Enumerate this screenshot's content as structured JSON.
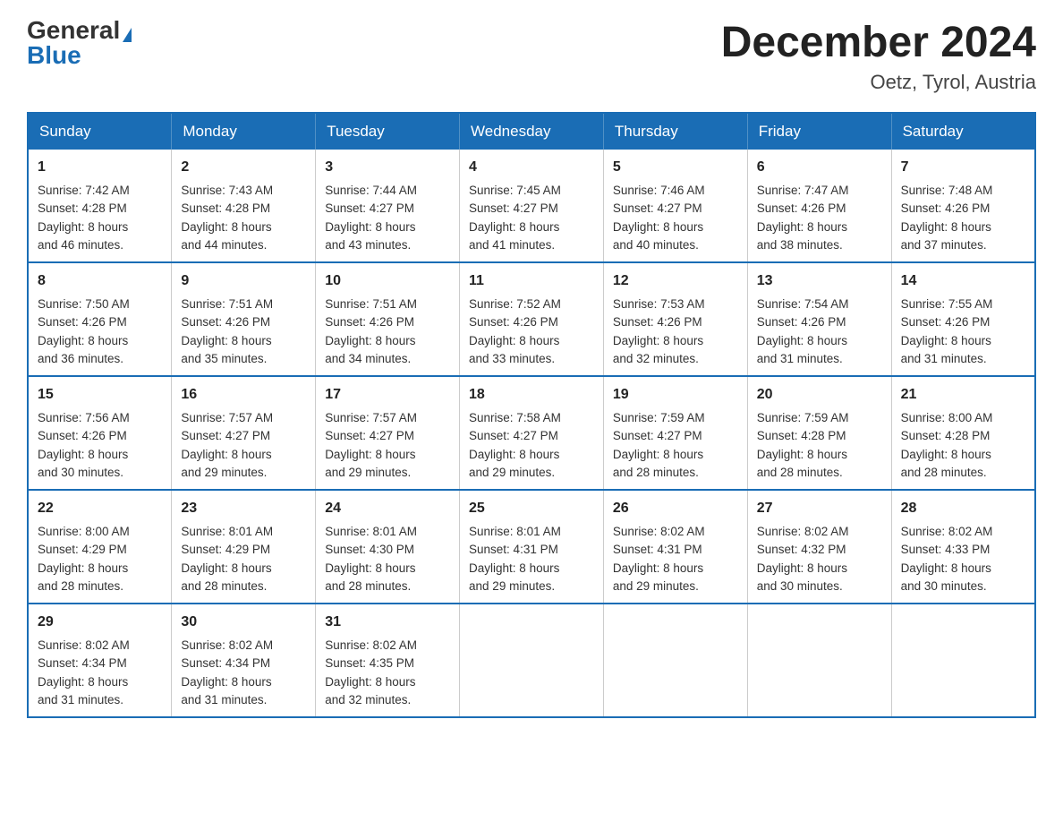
{
  "logo": {
    "general": "General",
    "blue": "Blue"
  },
  "title": "December 2024",
  "location": "Oetz, Tyrol, Austria",
  "days_of_week": [
    "Sunday",
    "Monday",
    "Tuesday",
    "Wednesday",
    "Thursday",
    "Friday",
    "Saturday"
  ],
  "weeks": [
    [
      {
        "day": "1",
        "sunrise": "7:42 AM",
        "sunset": "4:28 PM",
        "daylight": "8 hours and 46 minutes."
      },
      {
        "day": "2",
        "sunrise": "7:43 AM",
        "sunset": "4:28 PM",
        "daylight": "8 hours and 44 minutes."
      },
      {
        "day": "3",
        "sunrise": "7:44 AM",
        "sunset": "4:27 PM",
        "daylight": "8 hours and 43 minutes."
      },
      {
        "day": "4",
        "sunrise": "7:45 AM",
        "sunset": "4:27 PM",
        "daylight": "8 hours and 41 minutes."
      },
      {
        "day": "5",
        "sunrise": "7:46 AM",
        "sunset": "4:27 PM",
        "daylight": "8 hours and 40 minutes."
      },
      {
        "day": "6",
        "sunrise": "7:47 AM",
        "sunset": "4:26 PM",
        "daylight": "8 hours and 38 minutes."
      },
      {
        "day": "7",
        "sunrise": "7:48 AM",
        "sunset": "4:26 PM",
        "daylight": "8 hours and 37 minutes."
      }
    ],
    [
      {
        "day": "8",
        "sunrise": "7:50 AM",
        "sunset": "4:26 PM",
        "daylight": "8 hours and 36 minutes."
      },
      {
        "day": "9",
        "sunrise": "7:51 AM",
        "sunset": "4:26 PM",
        "daylight": "8 hours and 35 minutes."
      },
      {
        "day": "10",
        "sunrise": "7:51 AM",
        "sunset": "4:26 PM",
        "daylight": "8 hours and 34 minutes."
      },
      {
        "day": "11",
        "sunrise": "7:52 AM",
        "sunset": "4:26 PM",
        "daylight": "8 hours and 33 minutes."
      },
      {
        "day": "12",
        "sunrise": "7:53 AM",
        "sunset": "4:26 PM",
        "daylight": "8 hours and 32 minutes."
      },
      {
        "day": "13",
        "sunrise": "7:54 AM",
        "sunset": "4:26 PM",
        "daylight": "8 hours and 31 minutes."
      },
      {
        "day": "14",
        "sunrise": "7:55 AM",
        "sunset": "4:26 PM",
        "daylight": "8 hours and 31 minutes."
      }
    ],
    [
      {
        "day": "15",
        "sunrise": "7:56 AM",
        "sunset": "4:26 PM",
        "daylight": "8 hours and 30 minutes."
      },
      {
        "day": "16",
        "sunrise": "7:57 AM",
        "sunset": "4:27 PM",
        "daylight": "8 hours and 29 minutes."
      },
      {
        "day": "17",
        "sunrise": "7:57 AM",
        "sunset": "4:27 PM",
        "daylight": "8 hours and 29 minutes."
      },
      {
        "day": "18",
        "sunrise": "7:58 AM",
        "sunset": "4:27 PM",
        "daylight": "8 hours and 29 minutes."
      },
      {
        "day": "19",
        "sunrise": "7:59 AM",
        "sunset": "4:27 PM",
        "daylight": "8 hours and 28 minutes."
      },
      {
        "day": "20",
        "sunrise": "7:59 AM",
        "sunset": "4:28 PM",
        "daylight": "8 hours and 28 minutes."
      },
      {
        "day": "21",
        "sunrise": "8:00 AM",
        "sunset": "4:28 PM",
        "daylight": "8 hours and 28 minutes."
      }
    ],
    [
      {
        "day": "22",
        "sunrise": "8:00 AM",
        "sunset": "4:29 PM",
        "daylight": "8 hours and 28 minutes."
      },
      {
        "day": "23",
        "sunrise": "8:01 AM",
        "sunset": "4:29 PM",
        "daylight": "8 hours and 28 minutes."
      },
      {
        "day": "24",
        "sunrise": "8:01 AM",
        "sunset": "4:30 PM",
        "daylight": "8 hours and 28 minutes."
      },
      {
        "day": "25",
        "sunrise": "8:01 AM",
        "sunset": "4:31 PM",
        "daylight": "8 hours and 29 minutes."
      },
      {
        "day": "26",
        "sunrise": "8:02 AM",
        "sunset": "4:31 PM",
        "daylight": "8 hours and 29 minutes."
      },
      {
        "day": "27",
        "sunrise": "8:02 AM",
        "sunset": "4:32 PM",
        "daylight": "8 hours and 30 minutes."
      },
      {
        "day": "28",
        "sunrise": "8:02 AM",
        "sunset": "4:33 PM",
        "daylight": "8 hours and 30 minutes."
      }
    ],
    [
      {
        "day": "29",
        "sunrise": "8:02 AM",
        "sunset": "4:34 PM",
        "daylight": "8 hours and 31 minutes."
      },
      {
        "day": "30",
        "sunrise": "8:02 AM",
        "sunset": "4:34 PM",
        "daylight": "8 hours and 31 minutes."
      },
      {
        "day": "31",
        "sunrise": "8:02 AM",
        "sunset": "4:35 PM",
        "daylight": "8 hours and 32 minutes."
      },
      null,
      null,
      null,
      null
    ]
  ]
}
